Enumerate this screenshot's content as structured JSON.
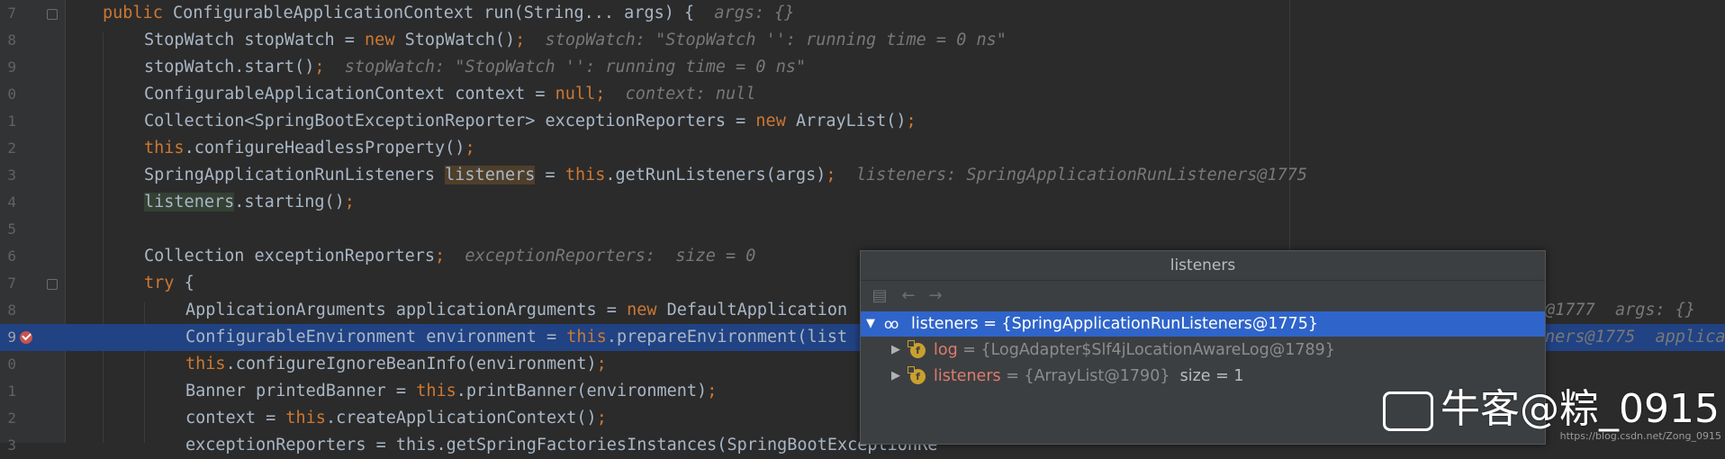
{
  "editor": {
    "lines": [
      {
        "no": "7",
        "segs": [
          {
            "t": "public ",
            "c": "kw"
          },
          {
            "t": "ConfigurableApplicationContext run(String... args) {  "
          },
          {
            "t": "args: {}",
            "c": "hint"
          }
        ]
      },
      {
        "no": "8",
        "segs": [
          {
            "t": "StopWatch stopWatch = "
          },
          {
            "t": "new ",
            "c": "kw"
          },
          {
            "t": "StopWatch()"
          },
          {
            "t": ";",
            "c": "kw"
          },
          {
            "t": "  stopWatch: \"StopWatch '': running time = 0 ns\"",
            "c": "hint"
          }
        ]
      },
      {
        "no": "9",
        "segs": [
          {
            "t": "stopWatch.start()"
          },
          {
            "t": ";",
            "c": "kw"
          },
          {
            "t": "  stopWatch: \"StopWatch '': running time = 0 ns\"",
            "c": "hint"
          }
        ]
      },
      {
        "no": "0",
        "segs": [
          {
            "t": "ConfigurableApplicationContext context = "
          },
          {
            "t": "null;",
            "c": "kw"
          },
          {
            "t": "  context: null",
            "c": "hint"
          }
        ]
      },
      {
        "no": "1",
        "segs": [
          {
            "t": "Collection<SpringBootExceptionReporter> exceptionReporters = "
          },
          {
            "t": "new ",
            "c": "kw"
          },
          {
            "t": "ArrayList()"
          },
          {
            "t": ";",
            "c": "kw"
          }
        ]
      },
      {
        "no": "2",
        "segs": [
          {
            "t": "this",
            "c": "kw"
          },
          {
            "t": ".configureHeadlessProperty()"
          },
          {
            "t": ";",
            "c": "kw"
          }
        ]
      },
      {
        "no": "3",
        "segs": [
          {
            "t": "SpringApplicationRunListeners "
          },
          {
            "t": "listeners",
            "c": "rhl"
          },
          {
            "t": " = "
          },
          {
            "t": "this",
            "c": "kw"
          },
          {
            "t": ".getRunListeners(args)"
          },
          {
            "t": ";",
            "c": "kw"
          },
          {
            "t": "  listeners: SpringApplicationRunListeners@1775",
            "c": "hint"
          }
        ]
      },
      {
        "no": "4",
        "segs": [
          {
            "t": "listeners",
            "c": "ghl"
          },
          {
            "t": ".starting()"
          },
          {
            "t": ";",
            "c": "kw"
          }
        ]
      },
      {
        "no": "5",
        "segs": []
      },
      {
        "no": "6",
        "segs": [
          {
            "t": "Collection exceptionReporters"
          },
          {
            "t": ";",
            "c": "kw"
          },
          {
            "t": "  exceptionReporters:  size = 0",
            "c": "hint"
          }
        ]
      },
      {
        "no": "7",
        "segs": [
          {
            "t": "try ",
            "c": "kw"
          },
          {
            "t": "{"
          }
        ]
      },
      {
        "no": "8",
        "segs": [
          {
            "t": "ApplicationArguments applicationArguments = "
          },
          {
            "t": "new ",
            "c": "kw"
          },
          {
            "t": "DefaultApplication"
          }
        ]
      },
      {
        "no": "9",
        "segs": [
          {
            "t": "ConfigurableEnvironment environment = "
          },
          {
            "t": "this",
            "c": "kw"
          },
          {
            "t": ".prepareEnvironment(list"
          }
        ]
      },
      {
        "no": "0",
        "segs": [
          {
            "t": "this",
            "c": "kw"
          },
          {
            "t": ".configureIgnoreBeanInfo(environment)"
          },
          {
            "t": ";",
            "c": "kw"
          }
        ]
      },
      {
        "no": "1",
        "segs": [
          {
            "t": "Banner printedBanner = "
          },
          {
            "t": "this",
            "c": "kw"
          },
          {
            "t": ".printBanner(environment)"
          },
          {
            "t": ";",
            "c": "kw"
          }
        ]
      },
      {
        "no": "2",
        "segs": [
          {
            "t": "context = "
          },
          {
            "t": "this",
            "c": "kw"
          },
          {
            "t": ".createApplicationContext()"
          },
          {
            "t": ";",
            "c": "kw"
          }
        ]
      },
      {
        "no": "3",
        "segs": [
          {
            "t": "exceptionReporters = this.getSpringFactoriesInstances(SpringBootExceptionRe",
            "c": "dim"
          }
        ]
      }
    ],
    "right_hints": [
      {
        "line": 11,
        "text": "@1777  args: {}"
      },
      {
        "line": 12,
        "text": "ners@1775  applica"
      }
    ]
  },
  "popup": {
    "title": "listeners",
    "tree": [
      {
        "name": "listeners",
        "value": " = {SpringApplicationRunListeners@1775}",
        "selected": true,
        "kind": "watch",
        "expanded": true
      },
      {
        "name": "log",
        "value": " = {LogAdapter$Slf4jLocationAwareLog@1789}",
        "selected": false,
        "kind": "field",
        "expanded": false
      },
      {
        "name": "listeners",
        "value": " = {ArrayList@1790}",
        "extra": "  size = 1",
        "selected": false,
        "kind": "field",
        "expanded": false
      }
    ]
  },
  "watermark": {
    "text": "牛客@粽_0915",
    "url": "https://blog.csdn.net/Zong_0915"
  }
}
